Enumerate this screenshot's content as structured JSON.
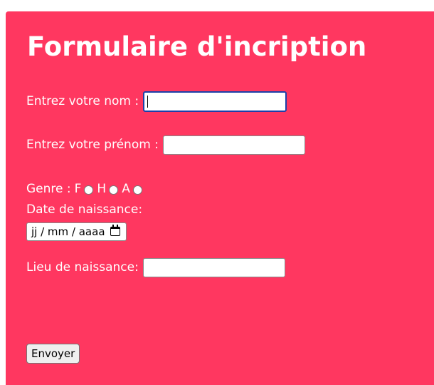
{
  "form": {
    "title": "Formulaire d'incription",
    "nom_label": "Entrez votre nom :",
    "nom_value": "",
    "prenom_label": "Entrez votre prénom :",
    "prenom_value": "",
    "genre_label": "Genre :",
    "genre_options": [
      "F",
      "H",
      "A"
    ],
    "date_label": "Date de naissance:",
    "date_placeholder": "jj / mm / aaaa",
    "lieu_label": "Lieu de naissance:",
    "lieu_value": "",
    "submit_label": "Envoyer"
  },
  "colors": {
    "panel_background": "#ff3760",
    "text": "#ffffff",
    "focus_border": "#1d3fa8"
  },
  "icons": {
    "date_picker": "calendar-icon"
  }
}
